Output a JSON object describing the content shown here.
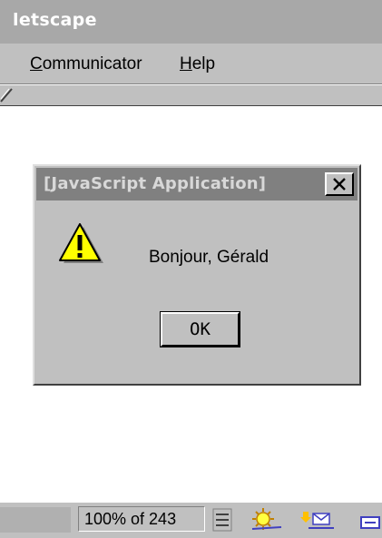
{
  "window": {
    "title": "letscape"
  },
  "menu": {
    "items": [
      {
        "label": "Communicator",
        "hotkey": "C",
        "rest": "ommunicator"
      },
      {
        "label": "Help",
        "hotkey": "H",
        "rest": "elp"
      }
    ]
  },
  "dialog": {
    "title": "[JavaScript Application]",
    "message": "Bonjour, Gérald",
    "ok_label": "OK",
    "close_label": "X",
    "icon": "warning-icon"
  },
  "status": {
    "progress_text": "100% of 243",
    "icons": [
      "component-bar-icon",
      "navigator-icon",
      "mail-icon",
      "composer-icon"
    ]
  },
  "colors": {
    "dialog_title_text": "#d8d8d8",
    "warning_yellow": "#ffff00"
  }
}
